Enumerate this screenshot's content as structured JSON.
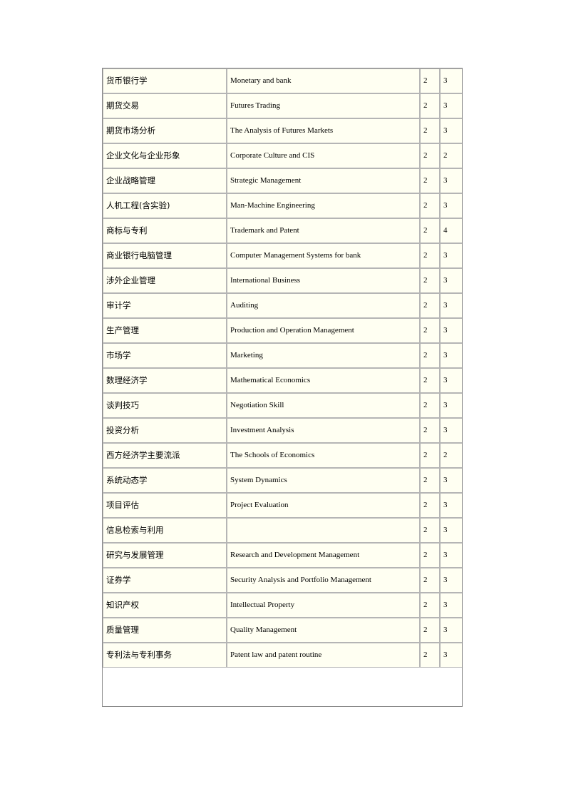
{
  "document": {
    "type": "course-list-table",
    "page_background": "#ffffff",
    "table": {
      "border_color": "#b5b5b5",
      "outer_border_color": "#8a8a8a",
      "cell_background": "#fffff2",
      "columns": [
        {
          "key": "name_cn",
          "label": ""
        },
        {
          "key": "name_en",
          "label": ""
        },
        {
          "key": "credits",
          "label": ""
        },
        {
          "key": "hours",
          "label": ""
        }
      ],
      "rows": [
        {
          "name_cn": "货币银行学",
          "name_en": "Monetary and bank",
          "credits": "2",
          "hours": "3"
        },
        {
          "name_cn": "期货交易",
          "name_en": "Futures Trading",
          "credits": "2",
          "hours": "3"
        },
        {
          "name_cn": "期货市场分析",
          "name_en": "The Analysis of Futures Markets",
          "credits": "2",
          "hours": "3"
        },
        {
          "name_cn": "企业文化与企业形象",
          "name_en": "Corporate Culture and CIS",
          "credits": "2",
          "hours": "2"
        },
        {
          "name_cn": "企业战略管理",
          "name_en": "Strategic Management",
          "credits": "2",
          "hours": "3"
        },
        {
          "name_cn": "人机工程(含实验)",
          "name_en": "Man-Machine Engineering",
          "credits": "2",
          "hours": "3"
        },
        {
          "name_cn": "商标与专利",
          "name_en": "Trademark and Patent",
          "credits": "2",
          "hours": "4"
        },
        {
          "name_cn": "商业银行电脑管理",
          "name_en": "Computer Management Systems for bank",
          "credits": "2",
          "hours": "3"
        },
        {
          "name_cn": "涉外企业管理",
          "name_en": "International Business",
          "credits": "2",
          "hours": "3"
        },
        {
          "name_cn": "审计学",
          "name_en": "Auditing",
          "credits": "2",
          "hours": "3"
        },
        {
          "name_cn": "生产管理",
          "name_en": "Production and Operation Management",
          "credits": "2",
          "hours": "3"
        },
        {
          "name_cn": "市场学",
          "name_en": "Marketing",
          "credits": "2",
          "hours": "3"
        },
        {
          "name_cn": "数理经济学",
          "name_en": "Mathematical Economics",
          "credits": "2",
          "hours": "3"
        },
        {
          "name_cn": "谈判技巧",
          "name_en": "Negotiation Skill",
          "credits": "2",
          "hours": "3"
        },
        {
          "name_cn": "投资分析",
          "name_en": "Investment Analysis",
          "credits": "2",
          "hours": "3"
        },
        {
          "name_cn": "西方经济学主要流派",
          "name_en": "The Schools of Economics",
          "credits": "2",
          "hours": "2"
        },
        {
          "name_cn": "系统动态学",
          "name_en": "System Dynamics",
          "credits": "2",
          "hours": "3"
        },
        {
          "name_cn": "项目评估",
          "name_en": "Project Evaluation",
          "credits": "2",
          "hours": "3"
        },
        {
          "name_cn": "信息检索与利用",
          "name_en": "",
          "credits": "2",
          "hours": "3"
        },
        {
          "name_cn": "研究与发展管理",
          "name_en": "Research and Development Management",
          "credits": "2",
          "hours": "3"
        },
        {
          "name_cn": "证券学",
          "name_en": "Security Analysis and Portfolio Management",
          "credits": "2",
          "hours": "3"
        },
        {
          "name_cn": "知识产权",
          "name_en": "Intellectual Property",
          "credits": "2",
          "hours": "3"
        },
        {
          "name_cn": "质量管理",
          "name_en": "Quality Management",
          "credits": "2",
          "hours": "3"
        },
        {
          "name_cn": "专利法与专利事务",
          "name_en": "Patent law and patent routine",
          "credits": "2",
          "hours": "3"
        }
      ]
    }
  }
}
